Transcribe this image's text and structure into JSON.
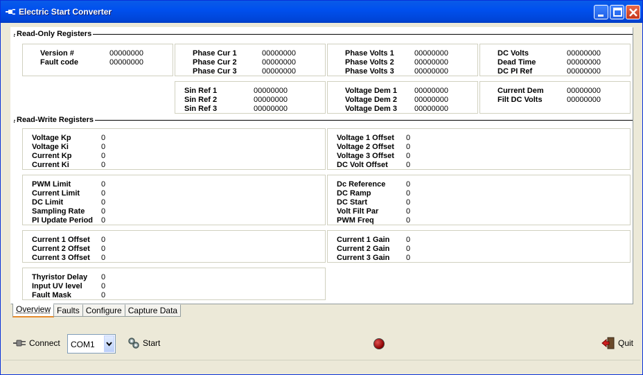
{
  "window": {
    "title": "Electric Start Converter"
  },
  "read_only": {
    "title": "Read-Only Registers",
    "boxes": [
      {
        "rows": [
          {
            "label": "Version #",
            "value": "00000000"
          },
          {
            "label": "Fault code",
            "value": "00000000"
          }
        ]
      },
      {
        "rows": [
          {
            "label": "Phase Cur 1",
            "value": "00000000"
          },
          {
            "label": "Phase Cur 2",
            "value": "00000000"
          },
          {
            "label": "Phase Cur 3",
            "value": "00000000"
          }
        ]
      },
      {
        "rows": [
          {
            "label": "Phase Volts 1",
            "value": "00000000"
          },
          {
            "label": "Phase Volts 2",
            "value": "00000000"
          },
          {
            "label": "Phase Volts 3",
            "value": "00000000"
          }
        ]
      },
      {
        "rows": [
          {
            "label": "DC Volts",
            "value": "00000000"
          },
          {
            "label": "Dead Time",
            "value": "00000000"
          },
          {
            "label": "DC PI Ref",
            "value": "00000000"
          }
        ]
      },
      {
        "rows": [
          {
            "label": "Sin Ref 1",
            "value": "00000000"
          },
          {
            "label": "Sin Ref 2",
            "value": "00000000"
          },
          {
            "label": "Sin Ref 3",
            "value": "00000000"
          }
        ]
      },
      {
        "rows": [
          {
            "label": "Voltage Dem 1",
            "value": "00000000"
          },
          {
            "label": "Voltage Dem 2",
            "value": "00000000"
          },
          {
            "label": "Voltage Dem 3",
            "value": "00000000"
          }
        ]
      },
      {
        "rows": [
          {
            "label": "Current Dem",
            "value": "00000000"
          },
          {
            "label": "Filt DC Volts",
            "value": "00000000"
          }
        ]
      }
    ]
  },
  "read_write": {
    "title": "Read-Write Registers",
    "boxes": [
      {
        "rows": [
          {
            "label": "Voltage Kp",
            "value": "0"
          },
          {
            "label": "Voltage Ki",
            "value": "0"
          },
          {
            "label": "Current Kp",
            "value": "0"
          },
          {
            "label": "Current Ki",
            "value": "0"
          }
        ]
      },
      {
        "rows": [
          {
            "label": "Voltage 1 Offset",
            "value": "0"
          },
          {
            "label": "Voltage 2 Offset",
            "value": "0"
          },
          {
            "label": "Voltage 3 Offset",
            "value": "0"
          },
          {
            "label": "DC Volt Offset",
            "value": "0"
          }
        ]
      },
      {
        "rows": [
          {
            "label": "PWM Limit",
            "value": "0"
          },
          {
            "label": "Current Limit",
            "value": "0"
          },
          {
            "label": "DC Limit",
            "value": "0"
          },
          {
            "label": "Sampling Rate",
            "value": "0"
          },
          {
            "label": "PI Update Period",
            "value": "0"
          }
        ]
      },
      {
        "rows": [
          {
            "label": "Dc Reference",
            "value": "0"
          },
          {
            "label": "DC Ramp",
            "value": "0"
          },
          {
            "label": "DC Start",
            "value": "0"
          },
          {
            "label": "Volt Filt Par",
            "value": "0"
          },
          {
            "label": "PWM Freq",
            "value": "0"
          }
        ]
      },
      {
        "rows": [
          {
            "label": "Current 1 Offset",
            "value": "0"
          },
          {
            "label": "Current 2 Offset",
            "value": "0"
          },
          {
            "label": "Current 3 Offset",
            "value": "0"
          }
        ]
      },
      {
        "rows": [
          {
            "label": "Current 1 Gain",
            "value": "0"
          },
          {
            "label": "Current 2 Gain",
            "value": "0"
          },
          {
            "label": "Current 3 Gain",
            "value": "0"
          }
        ]
      },
      {
        "rows": [
          {
            "label": "Thyristor Delay",
            "value": "0"
          },
          {
            "label": "Input UV level",
            "value": "0"
          },
          {
            "label": "Fault Mask",
            "value": "0"
          }
        ]
      }
    ]
  },
  "tabs": [
    "Overview",
    "Faults",
    "Configure",
    "Capture Data"
  ],
  "toolbar": {
    "connect_label": "Connect",
    "port_value": "COM1",
    "start_label": "Start",
    "quit_label": "Quit",
    "status_led_color": "#A01010"
  },
  "colors": {
    "titlebar": "#0054E3",
    "panel": "#FFFFFF",
    "face": "#ECE9D8",
    "tab_accent": "#E68B2C"
  }
}
